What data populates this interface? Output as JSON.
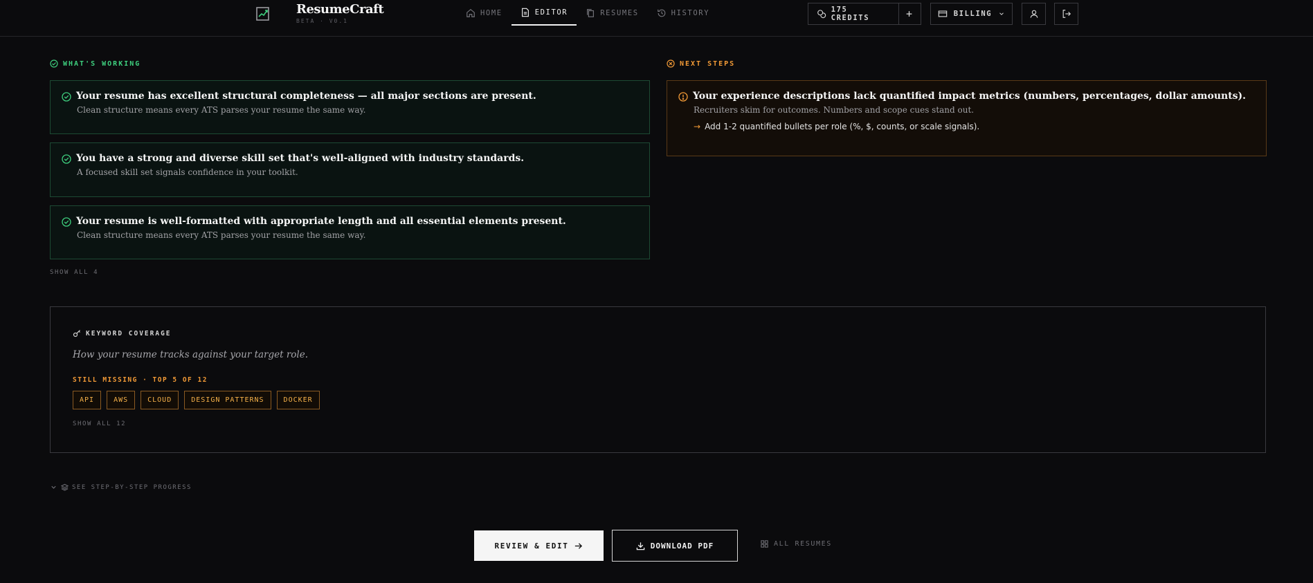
{
  "app": {
    "name": "ResumeCraft",
    "subtitle": "BETA · V0.1"
  },
  "nav": {
    "items": [
      {
        "label": "HOME",
        "icon": "home-icon",
        "active": false
      },
      {
        "label": "EDITOR",
        "icon": "document-icon",
        "active": true
      },
      {
        "label": "RESUMES",
        "icon": "copy-icon",
        "active": false
      },
      {
        "label": "HISTORY",
        "icon": "history-icon",
        "active": false
      }
    ]
  },
  "header": {
    "credits_label": "175 CREDITS",
    "add_label": "+",
    "billing_label": "BILLING"
  },
  "working": {
    "title": "WHAT'S WORKING",
    "items": [
      {
        "title": "Your resume has excellent structural completeness — all major sections are present.",
        "desc": "Clean structure means every ATS parses your resume the same way."
      },
      {
        "title": "You have a strong and diverse skill set that's well-aligned with industry standards.",
        "desc": "A focused skill set signals confidence in your toolkit."
      },
      {
        "title": "Your resume is well-formatted with appropriate length and all essential elements present.",
        "desc": "Clean structure means every ATS parses your resume the same way."
      }
    ],
    "show_all": "SHOW ALL 4"
  },
  "next_steps": {
    "title": "NEXT STEPS",
    "items": [
      {
        "title": "Your experience descriptions lack quantified impact metrics (numbers, percentages, dollar amounts).",
        "desc": "Recruiters skim for outcomes. Numbers and scope cues stand out.",
        "action": "Add 1-2 quantified bullets per role (%, $, counts, or scale signals)."
      }
    ]
  },
  "keywords": {
    "title": "KEYWORD COVERAGE",
    "subtitle": "How your resume tracks against your target role.",
    "missing_label": "STILL MISSING · TOP 5 OF 12",
    "missing": [
      "API",
      "AWS",
      "CLOUD",
      "DESIGN PATTERNS",
      "DOCKER"
    ],
    "show_all": "SHOW ALL 12"
  },
  "progress_toggle": "SEE STEP-BY-STEP PROGRESS",
  "actions": {
    "review": "REVIEW & EDIT",
    "download": "DOWNLOAD PDF",
    "all_resumes": "ALL RESUMES"
  },
  "colors": {
    "background": "#0b0b0d",
    "success": "#3ecf7e",
    "warning": "#f29a36"
  }
}
